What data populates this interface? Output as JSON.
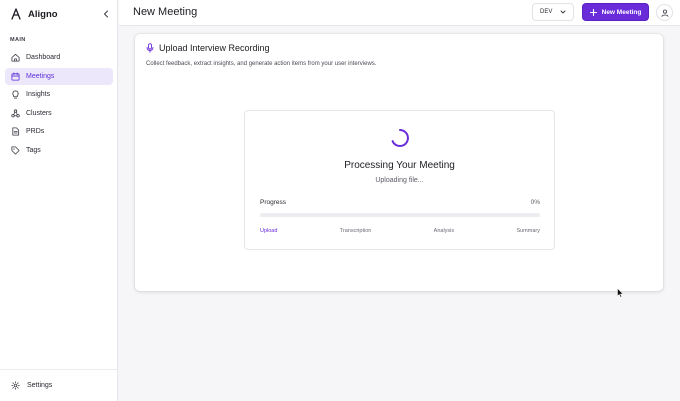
{
  "app": {
    "name": "Aligno"
  },
  "sidebar": {
    "section_label": "MAIN",
    "items": [
      {
        "label": "Dashboard",
        "icon": "dashboard-icon",
        "active": false
      },
      {
        "label": "Meetings",
        "icon": "calendar-icon",
        "active": true
      },
      {
        "label": "Insights",
        "icon": "lightbulb-icon",
        "active": false
      },
      {
        "label": "Clusters",
        "icon": "clusters-icon",
        "active": false
      },
      {
        "label": "PRDs",
        "icon": "document-icon",
        "active": false
      },
      {
        "label": "Tags",
        "icon": "tag-icon",
        "active": false
      }
    ],
    "settings_label": "Settings"
  },
  "header": {
    "title": "New Meeting",
    "env_value": "DEV",
    "new_meeting_label": "New Meeting"
  },
  "card": {
    "title": "Upload Interview Recording",
    "description": "Collect feedback, extract insights, and generate action items from your user interviews.",
    "processing": {
      "title": "Processing Your Meeting",
      "status": "Uploading file...",
      "progress_label": "Progress",
      "progress_text": "0%",
      "progress_value": 0,
      "steps": [
        {
          "label": "Upload",
          "current": true
        },
        {
          "label": "Transcription",
          "current": false
        },
        {
          "label": "Analysis",
          "current": false
        },
        {
          "label": "Summary",
          "current": false
        }
      ]
    }
  },
  "colors": {
    "accent": "#6a2bd9",
    "active_bg": "#ece7fb"
  }
}
